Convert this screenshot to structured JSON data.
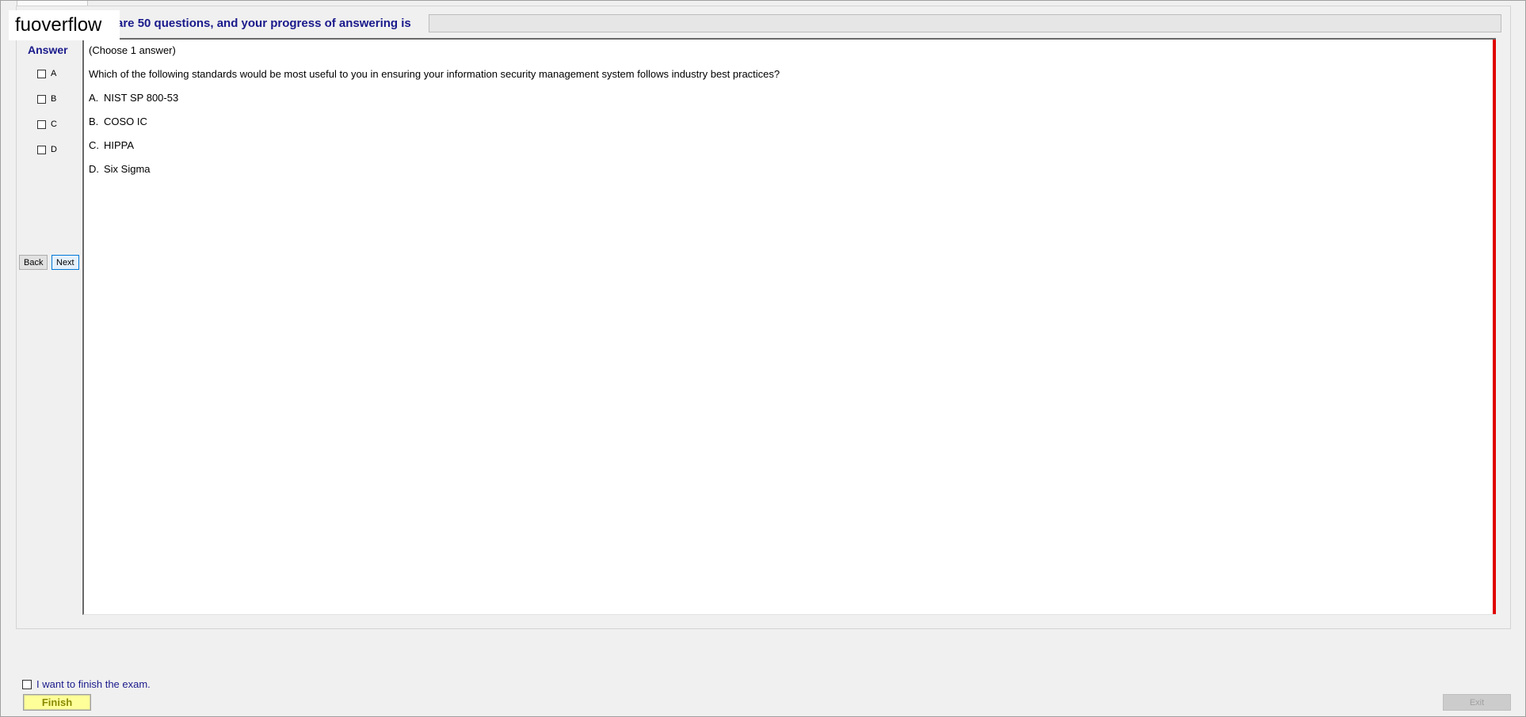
{
  "watermark": "fuoverflow",
  "header": {
    "text": "are 50 questions, and your progress of answering is",
    "progress_percent": 0
  },
  "answer_panel": {
    "title": "Answer",
    "options": [
      "A",
      "B",
      "C",
      "D"
    ]
  },
  "nav": {
    "back_label": "Back",
    "next_label": "Next"
  },
  "question": {
    "instruction": "(Choose 1 answer)",
    "text": "Which of the following standards would be most useful to you in ensuring your information security management system follows industry best practices?",
    "choices": [
      {
        "letter": "A.",
        "text": "NIST SP 800-53"
      },
      {
        "letter": "B.",
        "text": "COSO IC"
      },
      {
        "letter": "C.",
        "text": "HIPPA"
      },
      {
        "letter": "D.",
        "text": "Six Sigma"
      }
    ]
  },
  "footer": {
    "finish_check_label": "I want to finish the exam.",
    "finish_label": "Finish",
    "exit_label": "Exit"
  },
  "colors": {
    "accent_text": "#1a1a8c",
    "scroll_marker": "#e00000",
    "finish_bg": "#ffff99"
  }
}
